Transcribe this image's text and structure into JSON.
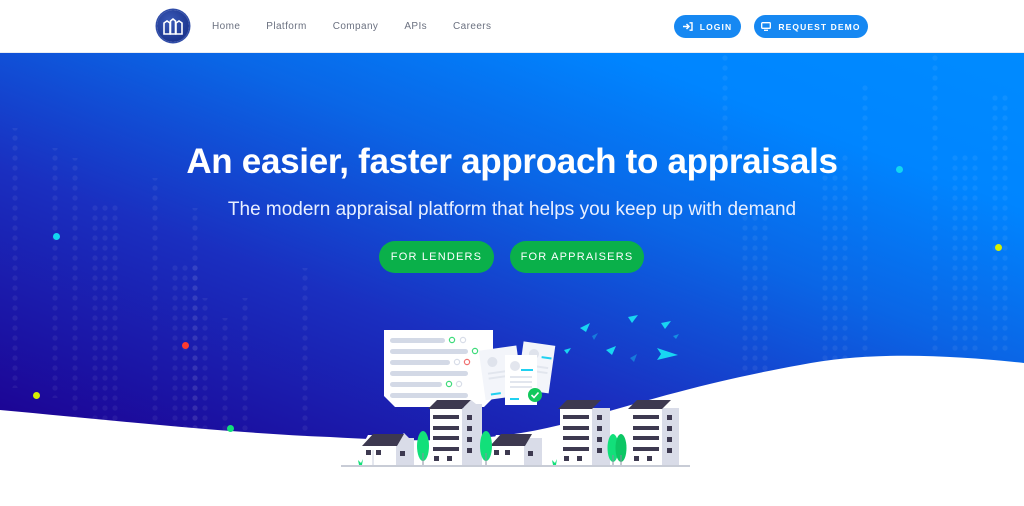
{
  "header": {
    "logo_icon": "buildings-logo-icon",
    "nav": [
      {
        "label": "Home"
      },
      {
        "label": "Platform"
      },
      {
        "label": "Company"
      },
      {
        "label": "APIs"
      },
      {
        "label": "Careers"
      }
    ],
    "login": {
      "label": "LOGIN",
      "icon": "sign-in-icon"
    },
    "request_demo": {
      "label": "REQUEST DEMO",
      "icon": "monitor-icon"
    }
  },
  "hero": {
    "title": "An easier, faster approach to appraisals",
    "subtitle": "The modern appraisal platform that helps you keep up with demand",
    "cta_lenders": "FOR LENDERS",
    "cta_appraisers": "FOR APPRAISERS",
    "colors": {
      "gradient_start": "#1c0090",
      "gradient_mid": "#0a5fdc",
      "gradient_end": "#0088ff",
      "cta_green": "#0ab04a",
      "accent_blue": "#1688f2"
    },
    "illustration": "appraisal-documents-and-buildings"
  }
}
